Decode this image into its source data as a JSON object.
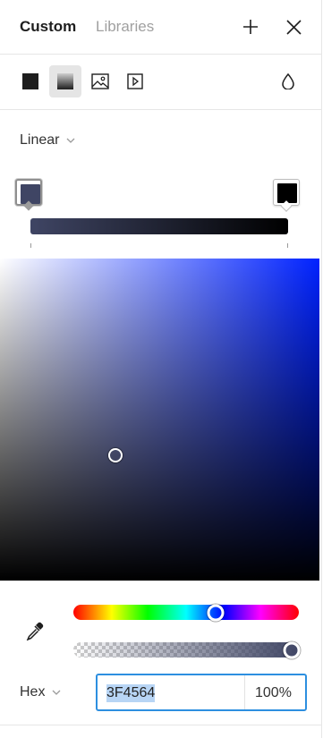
{
  "header": {
    "tabs": [
      {
        "label": "Custom",
        "active": true
      },
      {
        "label": "Libraries",
        "active": false
      }
    ],
    "add_icon": "plus-icon",
    "close_icon": "close-icon"
  },
  "fill_types": {
    "items": [
      {
        "name": "solid",
        "icon": "solid-fill-icon",
        "selected": false
      },
      {
        "name": "gradient",
        "icon": "gradient-fill-icon",
        "selected": true
      },
      {
        "name": "image",
        "icon": "image-fill-icon",
        "selected": false
      },
      {
        "name": "video",
        "icon": "video-fill-icon",
        "selected": false
      }
    ],
    "blend_icon": "blend-mode-icon"
  },
  "gradient": {
    "type_label": "Linear",
    "stops": [
      {
        "color": "#3F4564",
        "active": true
      },
      {
        "color": "#000000",
        "active": false
      }
    ]
  },
  "picker": {
    "hue_color": "#0022ff",
    "saturation": 0.36,
    "brightness": 0.39,
    "hue_position": 0.631,
    "alpha_position": 1.0
  },
  "color_input": {
    "format_label": "Hex",
    "hex_value": "3F4564",
    "opacity": "100%"
  },
  "colors": {
    "focus_border": "#2d8fe0",
    "selection_bg": "#b8d5f5"
  }
}
